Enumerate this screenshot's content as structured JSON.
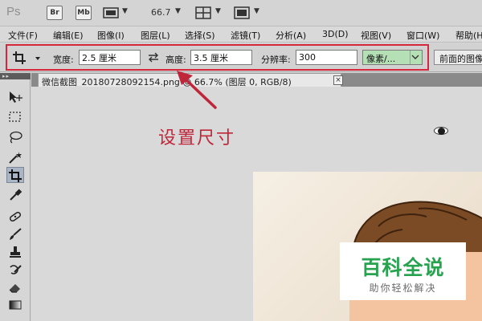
{
  "appbar": {
    "logo": "Ps",
    "bridge_label": "Br",
    "minibridge_label": "Mb",
    "zoom": "66.7",
    "caret": "▼"
  },
  "menubar": {
    "items": [
      "文件(F)",
      "编辑(E)",
      "图像(I)",
      "图层(L)",
      "选择(S)",
      "滤镜(T)",
      "分析(A)",
      "3D(D)",
      "视图(V)",
      "窗口(W)",
      "帮助(H)"
    ]
  },
  "options": {
    "width_label": "宽度:",
    "width_value": "2.5 厘米",
    "height_label": "高度:",
    "height_value": "3.5 厘米",
    "resolution_label": "分辨率:",
    "resolution_value": "300",
    "unit_value": "像素/...",
    "front_image_label": "前面的图像"
  },
  "document": {
    "tab_title": "微信截图_20180728092154.png @ 66.7% (图层 0, RGB/8)",
    "close_glyph": "×"
  },
  "annotation": {
    "text": "设置尺寸",
    "color": "#c0263a"
  },
  "watermark": {
    "title": "百科全说",
    "subtitle": "助你轻松解决",
    "title_color": "#27a34f"
  }
}
